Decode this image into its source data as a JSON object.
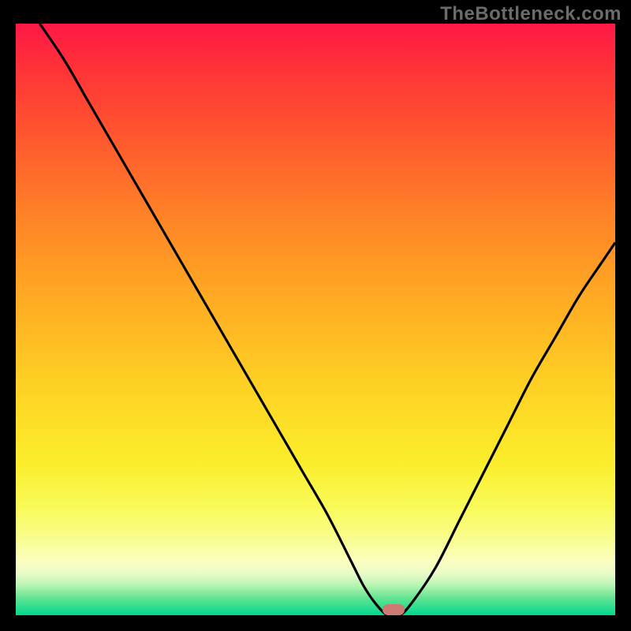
{
  "attribution": "TheBottleneck.com",
  "colors": {
    "page_bg": "#000000",
    "gradient_top": "#ff1846",
    "gradient_bottom": "#00d890",
    "curve": "#000000",
    "marker": "#cd7a72",
    "attribution_text": "#6b6b6b"
  },
  "chart_data": {
    "type": "line",
    "title": "",
    "xlabel": "",
    "ylabel": "",
    "xlim": [
      0,
      100
    ],
    "ylim": [
      0,
      100
    ],
    "x": [
      4,
      8,
      12,
      16,
      20,
      24,
      28,
      32,
      36,
      40,
      44,
      48,
      52,
      56,
      58,
      60,
      62,
      64,
      66,
      70,
      74,
      78,
      82,
      86,
      90,
      94,
      98,
      100
    ],
    "values": [
      100,
      94,
      87,
      80,
      73,
      66,
      59,
      52,
      45,
      38,
      31,
      24,
      17,
      9,
      5,
      2,
      0,
      0,
      2,
      8,
      16,
      24,
      32,
      40,
      47,
      54,
      60,
      63
    ],
    "marker": {
      "x": 63,
      "y": 0
    },
    "grid": false,
    "legend": false
  }
}
